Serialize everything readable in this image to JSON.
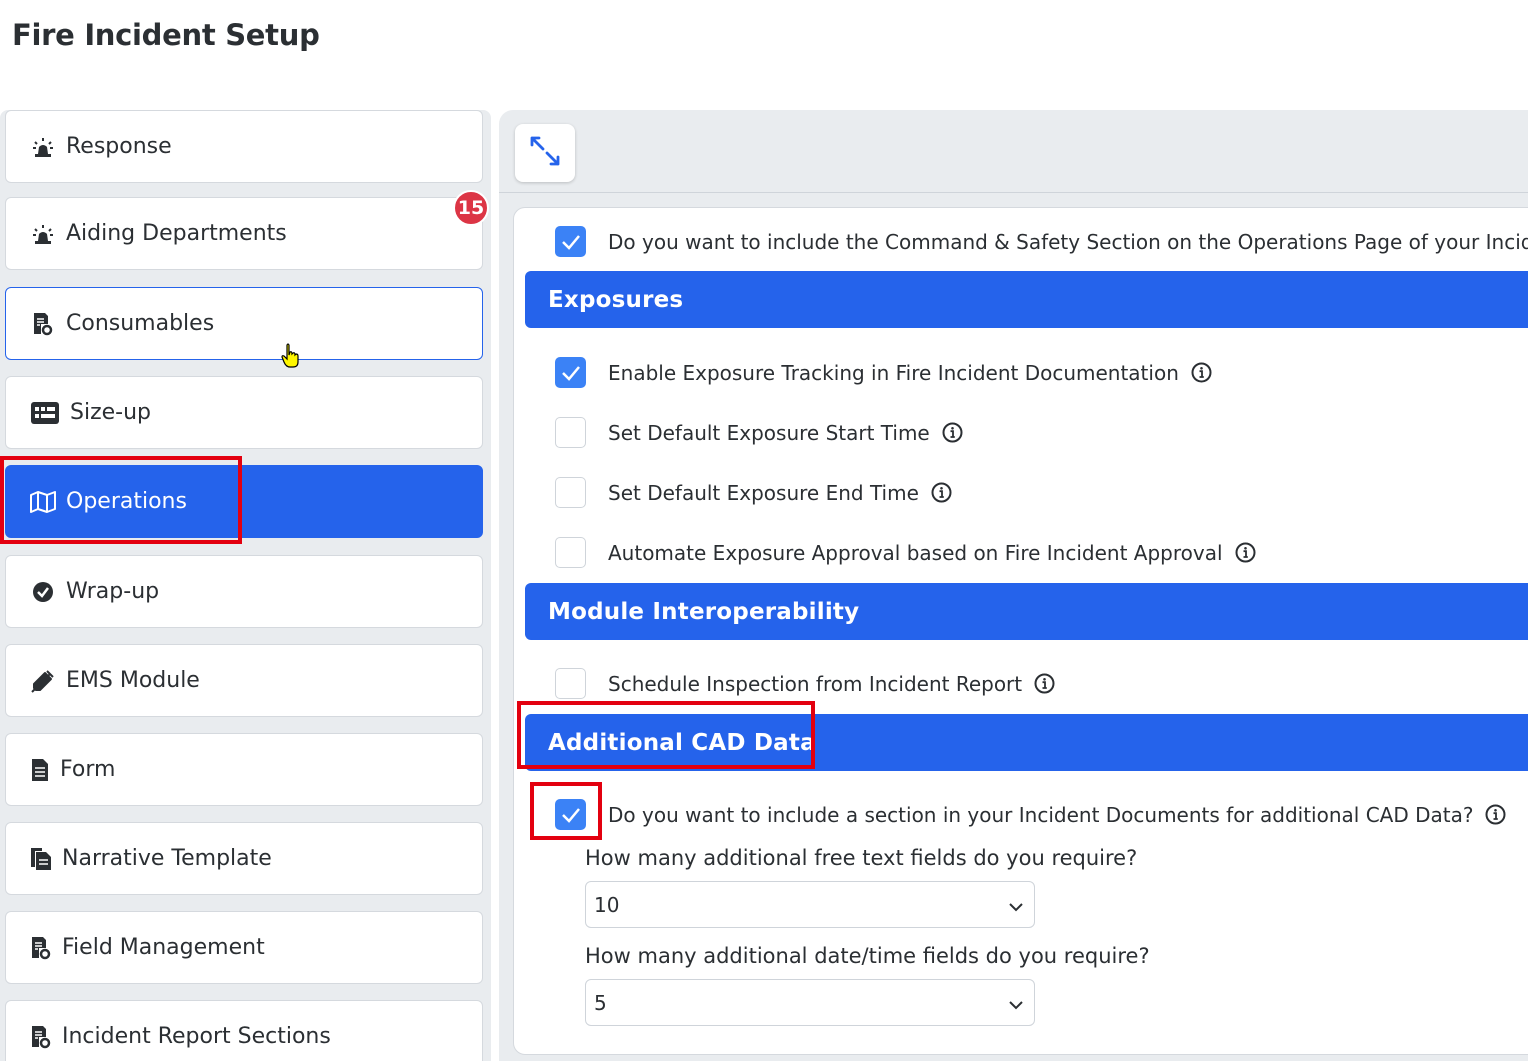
{
  "page": {
    "title": "Fire Incident Setup"
  },
  "sidebar": {
    "badge": "15",
    "items": [
      {
        "label": "Response",
        "icon": "siren-icon"
      },
      {
        "label": "Aiding Departments",
        "icon": "siren-icon"
      },
      {
        "label": "Consumables",
        "icon": "document-gear-icon"
      },
      {
        "label": "Size-up",
        "icon": "dashboard-card-icon"
      },
      {
        "label": "Operations",
        "icon": "map-icon"
      },
      {
        "label": "Wrap-up",
        "icon": "check-circle-icon"
      },
      {
        "label": "EMS Module",
        "icon": "syringe-icon"
      },
      {
        "label": "Form",
        "icon": "document-icon"
      },
      {
        "label": "Narrative Template",
        "icon": "copy-document-icon"
      },
      {
        "label": "Field Management",
        "icon": "document-gear-icon"
      },
      {
        "label": "Incident Report Sections",
        "icon": "document-gear-icon"
      }
    ]
  },
  "main": {
    "expand_icon": "expand-arrows-icon",
    "command_safety": {
      "label": "Do you want to include the Command & Safety Section on the Operations Page of your Inciden",
      "checked": true
    },
    "exposures": {
      "title": "Exposures",
      "options": [
        {
          "label": "Enable Exposure Tracking in Fire Incident Documentation",
          "checked": true
        },
        {
          "label": "Set Default Exposure Start Time",
          "checked": false
        },
        {
          "label": "Set Default Exposure End Time",
          "checked": false
        },
        {
          "label": "Automate Exposure Approval based on Fire Incident Approval",
          "checked": false
        }
      ]
    },
    "module_interop": {
      "title": "Module Interoperability",
      "options": [
        {
          "label": "Schedule Inspection from Incident Report",
          "checked": false
        }
      ]
    },
    "cad": {
      "title": "Additional CAD Data",
      "include": {
        "label": "Do you want to include a section in your Incident Documents for additional CAD Data?",
        "checked": true
      },
      "free_text_question": "How many additional free text fields do you require?",
      "free_text_value": "10",
      "datetime_question": "How many additional date/time fields do you require?",
      "datetime_value": "5"
    }
  },
  "colors": {
    "accent": "#2563eb",
    "checkbox": "#3b82f6",
    "badge": "#dc3545",
    "highlight": "#e3000f"
  }
}
